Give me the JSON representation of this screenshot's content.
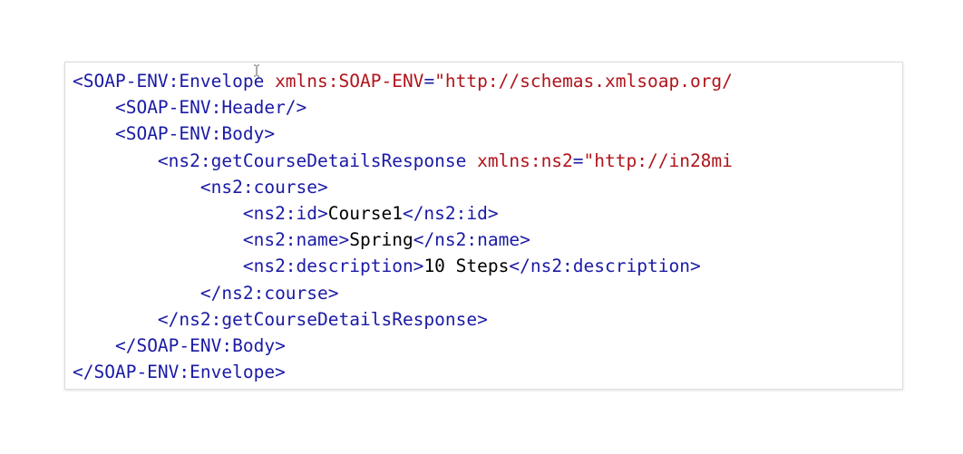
{
  "colors": {
    "tag": "#1a1aa6",
    "attribute": "#b0141c",
    "text": "#000000"
  },
  "code_lines": [
    {
      "indent": "",
      "tag_open": "<SOAP-ENV:Envelope ",
      "attr": "xmlns:SOAP-ENV",
      "eq": "=",
      "attr_value": "\"http://schemas.xmlsoap.org/"
    },
    {
      "indent": "    ",
      "tag": "<SOAP-ENV:Header/>"
    },
    {
      "indent": "    ",
      "tag": "<SOAP-ENV:Body>"
    },
    {
      "indent": "        ",
      "tag_open": "<ns2:getCourseDetailsResponse ",
      "attr": "xmlns:ns2",
      "eq": "=",
      "attr_value": "\"http://in28mi"
    },
    {
      "indent": "            ",
      "tag": "<ns2:course>"
    },
    {
      "indent": "                ",
      "open": "<ns2:id>",
      "text": "Course1",
      "close": "</ns2:id>"
    },
    {
      "indent": "                ",
      "open": "<ns2:name>",
      "text": "Spring",
      "close": "</ns2:name>"
    },
    {
      "indent": "                ",
      "open": "<ns2:description>",
      "text": "10 Steps",
      "close": "</ns2:description>"
    },
    {
      "indent": "            ",
      "tag": "</ns2:course>"
    },
    {
      "indent": "        ",
      "tag": "</ns2:getCourseDetailsResponse>"
    },
    {
      "indent": "    ",
      "tag": "</SOAP-ENV:Body>"
    },
    {
      "indent": "",
      "tag": "</SOAP-ENV:Envelope>"
    }
  ],
  "cursor_icon": "text-cursor-icon"
}
